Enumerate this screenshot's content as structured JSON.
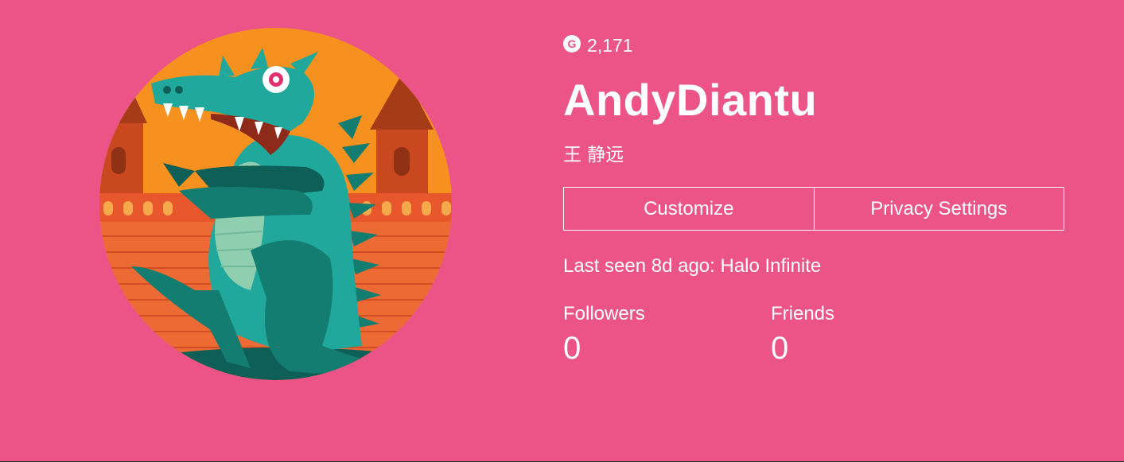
{
  "profile": {
    "gamerscore_icon": "G",
    "gamerscore": "2,171",
    "gamertag": "AndyDiantu",
    "real_name": "王 静远",
    "customize_label": "Customize",
    "privacy_label": "Privacy Settings",
    "last_seen": "Last seen 8d ago: Halo Infinite",
    "followers_label": "Followers",
    "followers_count": "0",
    "friends_label": "Friends",
    "friends_count": "0"
  },
  "colors": {
    "background": "#ec5488",
    "text": "#ffffff",
    "avatar_sky": "#f6901e",
    "avatar_wall": "#e8572b",
    "avatar_dino": "#1fa89b"
  },
  "icons": {
    "avatar": "dinosaur-avatar",
    "gamerscore": "gamerscore-icon"
  }
}
